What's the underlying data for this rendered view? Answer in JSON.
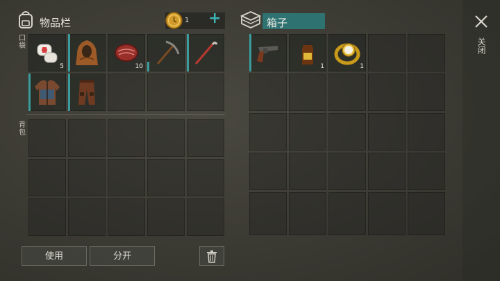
{
  "inventory": {
    "title": "物品栏",
    "coins": "1",
    "add_label": "+",
    "pockets_label": "口袋",
    "backpack_label": "背包",
    "pocket_items": [
      {
        "icon": "bandage-icon",
        "count": "5"
      },
      {
        "icon": "hood-icon",
        "count": ""
      },
      {
        "icon": "meat-icon",
        "count": "10"
      },
      {
        "icon": "pickaxe-icon",
        "count": ""
      },
      {
        "icon": "crowbar-icon",
        "count": ""
      },
      {
        "icon": "jacket-icon",
        "count": ""
      },
      {
        "icon": "pants-icon",
        "count": ""
      }
    ],
    "use_label": "使用",
    "split_label": "分开"
  },
  "container": {
    "title": "箱子",
    "items": [
      {
        "icon": "revolver-icon",
        "count": ""
      },
      {
        "icon": "bottle-icon",
        "count": "1"
      },
      {
        "icon": "watch-icon",
        "count": "1"
      }
    ]
  },
  "close_label": "关闭",
  "colors": {
    "accent": "#3a9c9c",
    "title_bar": "#2e7272",
    "background": "#3b3a33"
  }
}
